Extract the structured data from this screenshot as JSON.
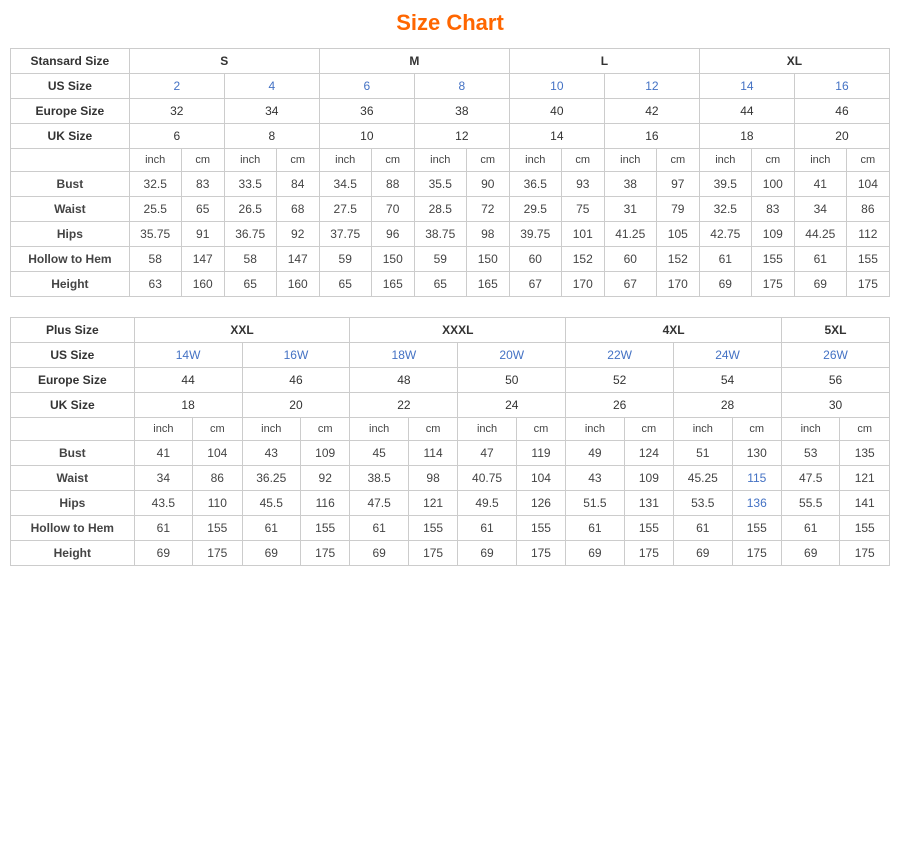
{
  "title": "Size Chart",
  "standard": {
    "section_label": "Stansard Size",
    "size_groups": [
      "S",
      "M",
      "L",
      "XL"
    ],
    "us_sizes": [
      "2",
      "4",
      "6",
      "8",
      "10",
      "12",
      "14",
      "16"
    ],
    "europe_sizes": [
      "32",
      "34",
      "36",
      "38",
      "40",
      "42",
      "44",
      "46"
    ],
    "uk_sizes": [
      "6",
      "8",
      "10",
      "12",
      "14",
      "16",
      "18",
      "20"
    ],
    "measurements": {
      "bust": [
        "32.5",
        "83",
        "33.5",
        "84",
        "34.5",
        "88",
        "35.5",
        "90",
        "36.5",
        "93",
        "38",
        "97",
        "39.5",
        "100",
        "41",
        "104"
      ],
      "waist": [
        "25.5",
        "65",
        "26.5",
        "68",
        "27.5",
        "70",
        "28.5",
        "72",
        "29.5",
        "75",
        "31",
        "79",
        "32.5",
        "83",
        "34",
        "86"
      ],
      "hips": [
        "35.75",
        "91",
        "36.75",
        "92",
        "37.75",
        "96",
        "38.75",
        "98",
        "39.75",
        "101",
        "41.25",
        "105",
        "42.75",
        "109",
        "44.25",
        "112"
      ],
      "hollow_to_hem": [
        "58",
        "147",
        "58",
        "147",
        "59",
        "150",
        "59",
        "150",
        "60",
        "152",
        "60",
        "152",
        "61",
        "155",
        "61",
        "155"
      ],
      "height": [
        "63",
        "160",
        "65",
        "160",
        "65",
        "165",
        "65",
        "165",
        "67",
        "170",
        "67",
        "170",
        "69",
        "175",
        "69",
        "175"
      ]
    },
    "row_labels": [
      "Bust",
      "Waist",
      "Hips",
      "Hollow to Hem",
      "Height"
    ]
  },
  "plus": {
    "section_label": "Plus Size",
    "size_groups": [
      "XXL",
      "XXXL",
      "4XL",
      "5XL"
    ],
    "us_sizes": [
      "14W",
      "16W",
      "18W",
      "20W",
      "22W",
      "24W",
      "26W"
    ],
    "europe_sizes": [
      "44",
      "46",
      "48",
      "50",
      "52",
      "54",
      "56"
    ],
    "uk_sizes": [
      "18",
      "20",
      "22",
      "24",
      "26",
      "28",
      "30"
    ],
    "measurements": {
      "bust": [
        "41",
        "104",
        "43",
        "109",
        "45",
        "114",
        "47",
        "119",
        "49",
        "124",
        "51",
        "130",
        "53",
        "135"
      ],
      "waist": [
        "34",
        "86",
        "36.25",
        "92",
        "38.5",
        "98",
        "40.75",
        "104",
        "43",
        "109",
        "45.25",
        "115",
        "47.5",
        "121"
      ],
      "hips": [
        "43.5",
        "110",
        "45.5",
        "116",
        "47.5",
        "121",
        "49.5",
        "126",
        "51.5",
        "131",
        "53.5",
        "136",
        "55.5",
        "141"
      ],
      "hollow_to_hem": [
        "61",
        "155",
        "61",
        "155",
        "61",
        "155",
        "61",
        "155",
        "61",
        "155",
        "61",
        "155",
        "61",
        "155"
      ],
      "height": [
        "69",
        "175",
        "69",
        "175",
        "69",
        "175",
        "69",
        "175",
        "69",
        "175",
        "69",
        "175",
        "69",
        "175"
      ]
    },
    "row_labels": [
      "Bust",
      "Waist",
      "Hips",
      "Hollow to Hem",
      "Height"
    ]
  },
  "units": {
    "inch": "inch",
    "cm": "cm"
  }
}
